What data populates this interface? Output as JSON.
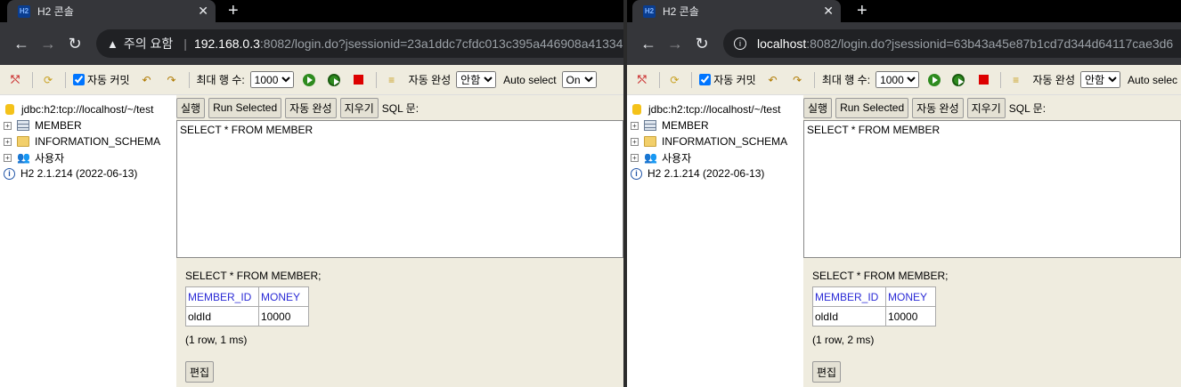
{
  "windows": [
    {
      "tab_title": "H2 콘솔",
      "favicon": "H2",
      "address": {
        "security_label": "주의 요함",
        "host": "192.168.0.3",
        "path": ":8082/login.do?jsessionid=23a1ddc7cfdc013c395a446908a41334"
      },
      "toolbar": {
        "auto_commit": "자동 커밋",
        "max_rows_label": "최대 행 수:",
        "max_rows_value": "1000",
        "autocomplete_label": "자동 완성",
        "autocomplete_value": "안함",
        "auto_select_label": "Auto select",
        "auto_select_value": "On"
      },
      "tree": {
        "connection": "jdbc:h2:tcp://localhost/~/test",
        "items": [
          "MEMBER",
          "INFORMATION_SCHEMA",
          "사용자"
        ],
        "version": "H2 2.1.214 (2022-06-13)"
      },
      "buttons": {
        "run": "실행",
        "run_selected": "Run Selected",
        "autocomplete": "자동 완성",
        "clear": "지우기",
        "sql_label": "SQL 문:"
      },
      "sql": "SELECT * FROM MEMBER",
      "result": {
        "query": "SELECT * FROM MEMBER;",
        "columns": [
          "MEMBER_ID",
          "MONEY"
        ],
        "rows": [
          [
            "oldId",
            "10000"
          ]
        ],
        "status": "(1 row, 1 ms)",
        "edit": "편집"
      }
    },
    {
      "tab_title": "H2 콘솔",
      "favicon": "H2",
      "address": {
        "host": "localhost",
        "path": ":8082/login.do?jsessionid=63b43a45e87b1cd7d344d64117cae3d6"
      },
      "toolbar": {
        "auto_commit": "자동 커밋",
        "max_rows_label": "최대 행 수:",
        "max_rows_value": "1000",
        "autocomplete_label": "자동 완성",
        "autocomplete_value": "안함",
        "auto_select_label": "Auto selec"
      },
      "tree": {
        "connection": "jdbc:h2:tcp://localhost/~/test",
        "items": [
          "MEMBER",
          "INFORMATION_SCHEMA",
          "사용자"
        ],
        "version": "H2 2.1.214 (2022-06-13)"
      },
      "buttons": {
        "run": "실행",
        "run_selected": "Run Selected",
        "autocomplete": "자동 완성",
        "clear": "지우기",
        "sql_label": "SQL 문:"
      },
      "sql": "SELECT * FROM MEMBER",
      "result": {
        "query": "SELECT * FROM MEMBER;",
        "columns": [
          "MEMBER_ID",
          "MONEY"
        ],
        "rows": [
          [
            "oldId",
            "10000"
          ]
        ],
        "status": "(1 row, 2 ms)",
        "edit": "편집"
      }
    }
  ]
}
